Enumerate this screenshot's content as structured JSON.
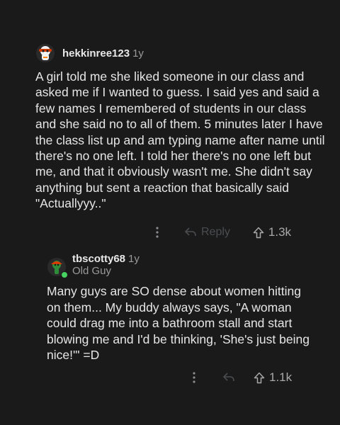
{
  "comments": [
    {
      "username": "hekkinree123",
      "age": "1y",
      "body": "A girl told me she liked someone in our class and asked me if I wanted to guess. I said yes and said a few names I remembered of students in our class and she said no to all of them. 5 minutes later I have the class list up and am typing name after name until there's no one left. I told her there's no one left but me, and that it obviously wasn't me. She didn't say anything but sent a reaction that basically said \"Actuallyyy..\"",
      "reply_label": "Reply",
      "score": "1.3k",
      "icons": {
        "more": "more-vertical-icon",
        "reply": "reply-arrow-icon",
        "upvote": "upvote-arrow-icon"
      }
    },
    {
      "username": "tbscotty68",
      "age": "1y",
      "flair": "Old Guy",
      "body": "Many guys are SO dense about women hitting on them...  My buddy always says, \"A woman could drag me into a bathroom stall and start blowing me and I'd be thinking, 'She's just being nice!'\"  =D",
      "score": "1.1k",
      "online": true,
      "icons": {
        "more": "more-vertical-icon",
        "reply": "reply-arrow-icon",
        "upvote": "upvote-arrow-icon"
      }
    }
  ],
  "colors": {
    "background": "#1a1a1b",
    "text": "#e6e6e6",
    "muted": "#9a9a9a",
    "online": "#46d160"
  }
}
